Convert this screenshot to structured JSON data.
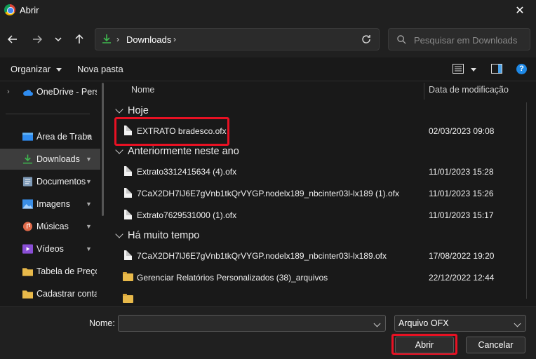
{
  "window": {
    "title": "Abrir",
    "close_glyph": "✕"
  },
  "address": {
    "root_sep": "›",
    "crumb": "Downloads",
    "end_sep": "›"
  },
  "search": {
    "placeholder": "Pesquisar em Downloads"
  },
  "toolbar": {
    "organize": "Organizar",
    "new_folder": "Nova pasta",
    "help": "?"
  },
  "sidebar": {
    "items": [
      {
        "label": "OneDrive - Pers",
        "icon": "cloud-icon",
        "chevron": "›"
      },
      {
        "label": "Área de Traba",
        "icon": "desktop-icon",
        "pinned": true
      },
      {
        "label": "Downloads",
        "icon": "download-icon",
        "pinned": true,
        "selected": true
      },
      {
        "label": "Documentos",
        "icon": "document-icon",
        "pinned": true
      },
      {
        "label": "Imagens",
        "icon": "image-icon",
        "pinned": true
      },
      {
        "label": "Músicas",
        "icon": "music-icon",
        "pinned": true
      },
      {
        "label": "Vídeos",
        "icon": "video-icon",
        "pinned": true
      },
      {
        "label": "Tabela de Preços",
        "icon": "folder-icon"
      },
      {
        "label": "Cadastrar conta",
        "icon": "folder-icon"
      }
    ],
    "pin_glyph": "📌"
  },
  "columns": {
    "name": "Nome",
    "date": "Data de modificação"
  },
  "groups": {
    "today": "Hoje",
    "this_year": "Anteriormente neste ano",
    "long_ago": "Há muito tempo"
  },
  "files": [
    {
      "name": "EXTRATO bradesco.ofx",
      "date": "02/03/2023 09:08",
      "type": "file"
    },
    {
      "name": "Extrato3312415634 (4).ofx",
      "date": "11/01/2023 15:28",
      "type": "file"
    },
    {
      "name": "7CaX2DH7lJ6E7gVnb1tkQrVYGP.nodelx189_nbcinter03l-lx189 (1).ofx",
      "date": "11/01/2023 15:26",
      "type": "file"
    },
    {
      "name": "Extrato7629531000 (1).ofx",
      "date": "11/01/2023 15:17",
      "type": "file"
    },
    {
      "name": "7CaX2DH7lJ6E7gVnb1tkQrVYGP.nodelx189_nbcinter03l-lx189.ofx",
      "date": "17/08/2022 19:20",
      "type": "file"
    },
    {
      "name": "Gerenciar Relatórios Personalizados (38)_arquivos",
      "date": "22/12/2022 12:44",
      "type": "folder"
    }
  ],
  "footer": {
    "name_label": "Nome:",
    "name_value": "",
    "file_type": "Arquivo OFX",
    "open_button": "Abrir",
    "cancel_button": "Cancelar"
  },
  "colors": {
    "highlight": "#e81123",
    "accent": "#1e88e5",
    "download_green": "#3fb950"
  }
}
